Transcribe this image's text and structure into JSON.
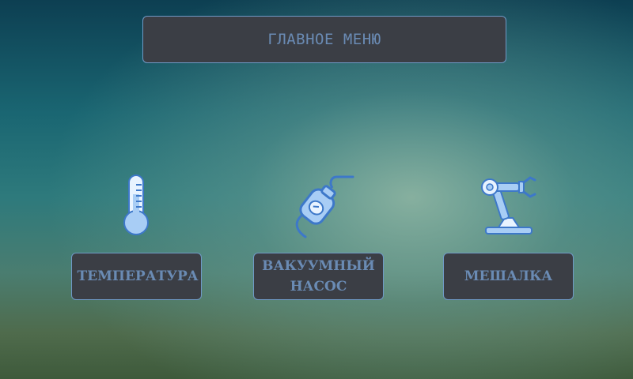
{
  "header": {
    "title": "ГЛАВНОЕ МЕНЮ"
  },
  "menu": {
    "items": [
      {
        "label": "ТЕМПЕРАТУРА",
        "icon": "thermometer-icon"
      },
      {
        "label": "ВАКУУМНЫЙ НАСОС",
        "icon": "vacuum-pump-icon"
      },
      {
        "label": "МЕШАЛКА",
        "icon": "robot-arm-icon"
      }
    ]
  },
  "colors": {
    "button_bg": "#3b3e45",
    "button_border": "#6f9ac6",
    "button_text": "#6a8bb4",
    "icon_fill": "#a8cdf5",
    "icon_stroke": "#3d78c9"
  }
}
